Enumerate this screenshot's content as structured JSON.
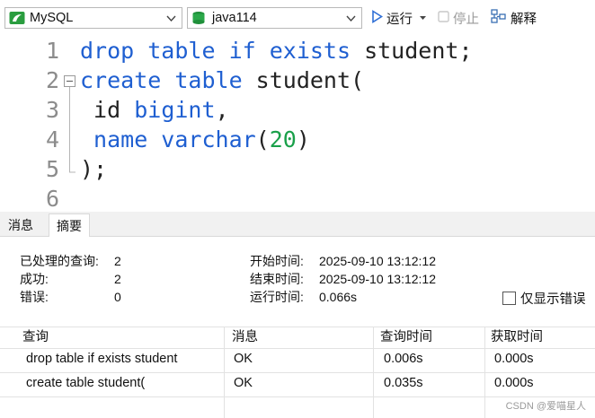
{
  "toolbar": {
    "connection": "MySQL",
    "database": "java114",
    "run_label": "运行",
    "stop_label": "停止",
    "explain_label": "解释"
  },
  "editor": {
    "lines": [
      {
        "num": "1",
        "tokens": [
          {
            "t": "drop table if exists",
            "c": "kw"
          },
          {
            "t": " student;",
            "c": "plain"
          }
        ]
      },
      {
        "num": "2",
        "tokens": [
          {
            "t": "create table",
            "c": "kw"
          },
          {
            "t": " student(",
            "c": "plain"
          }
        ]
      },
      {
        "num": "3",
        "tokens": [
          {
            "t": " id ",
            "c": "plain"
          },
          {
            "t": "bigint",
            "c": "kw"
          },
          {
            "t": ",",
            "c": "plain"
          }
        ]
      },
      {
        "num": "4",
        "tokens": [
          {
            "t": " name varchar",
            "c": "kw"
          },
          {
            "t": "(",
            "c": "plain"
          },
          {
            "t": "20",
            "c": "num"
          },
          {
            "t": ")",
            "c": "plain"
          }
        ]
      },
      {
        "num": "5",
        "tokens": [
          {
            "t": ");",
            "c": "plain"
          }
        ]
      },
      {
        "num": "6",
        "tokens": []
      }
    ]
  },
  "tabs": [
    {
      "label": "消息",
      "active": false
    },
    {
      "label": "摘要",
      "active": true
    }
  ],
  "summary": {
    "processed_label": "已处理的查询:",
    "processed_value": "2",
    "success_label": "成功:",
    "success_value": "2",
    "error_label": "错误:",
    "error_value": "0",
    "start_label": "开始时间:",
    "start_value": "2025-09-10 13:12:12",
    "end_label": "结束时间:",
    "end_value": "2025-09-10 13:12:12",
    "elapsed_label": "运行时间:",
    "elapsed_value": "0.066s",
    "only_errors_label": "仅显示错误"
  },
  "results": {
    "columns": [
      "查询",
      "消息",
      "查询时间",
      "获取时间"
    ],
    "rows": [
      [
        "drop table if exists student",
        "OK",
        "0.006s",
        "0.000s"
      ],
      [
        "create table student(",
        "OK",
        "0.035s",
        "0.000s"
      ]
    ]
  },
  "watermark": "CSDN @爱喵星人"
}
